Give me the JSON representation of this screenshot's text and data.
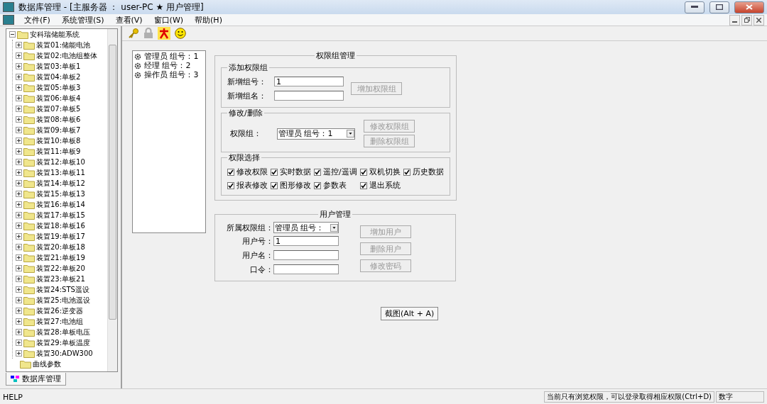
{
  "window": {
    "title": "数据库管理 - [主服务器 ： user-PC ★ 用户管理]"
  },
  "menu": [
    "文件(F)",
    "系统管理(S)",
    "查看(V)",
    "窗口(W)",
    "帮助(H)"
  ],
  "tree": {
    "label": "安科瑞储能系统",
    "expanded": true,
    "children": [
      {
        "label": "装置01:储能电池"
      },
      {
        "label": "装置02:电池组整体"
      },
      {
        "label": "装置03:单板1"
      },
      {
        "label": "装置04:单板2"
      },
      {
        "label": "装置05:单板3"
      },
      {
        "label": "装置06:单板4"
      },
      {
        "label": "装置07:单板5"
      },
      {
        "label": "装置08:单板6"
      },
      {
        "label": "装置09:单板7"
      },
      {
        "label": "装置10:单板8"
      },
      {
        "label": "装置11:单板9"
      },
      {
        "label": "装置12:单板10"
      },
      {
        "label": "装置13:单板11"
      },
      {
        "label": "装置14:单板12"
      },
      {
        "label": "装置15:单板13"
      },
      {
        "label": "装置16:单板14"
      },
      {
        "label": "装置17:单板15"
      },
      {
        "label": "装置18:单板16"
      },
      {
        "label": "装置19:单板17"
      },
      {
        "label": "装置20:单板18"
      },
      {
        "label": "装置21:单板19"
      },
      {
        "label": "装置22:单板20"
      },
      {
        "label": "装置23:单板21"
      },
      {
        "label": "装置24:STS遥设"
      },
      {
        "label": "装置25:电池遥设"
      },
      {
        "label": "装置26:逆变器"
      },
      {
        "label": "装置27:电池组"
      },
      {
        "label": "装置28:单板电压"
      },
      {
        "label": "装置29:单板温度"
      },
      {
        "label": "装置30:ADW300"
      }
    ]
  },
  "tree_extra": [
    "曲线参数"
  ],
  "left_tab": "数据库管理",
  "groups_list": [
    "管理员 组号：1",
    "经理 组号：2",
    "操作员 组号：3"
  ],
  "group_mgmt": {
    "title": "权限组管理",
    "add": {
      "title": "添加权限组",
      "fields": [
        {
          "label": "新增组号：",
          "value": "1"
        },
        {
          "label": "新增组名："
        }
      ],
      "button": {
        "label": "增加权限组",
        "disabled": true
      }
    },
    "edit": {
      "title": "修改/删除",
      "label": "权限组：",
      "value": "管理员 组号：1",
      "buttons": [
        {
          "label": "修改权限组",
          "disabled": true
        },
        {
          "label": "删除权限组",
          "disabled": true
        }
      ]
    },
    "perms": {
      "title": "权限选择",
      "items": [
        {
          "label": "修改权限",
          "checked": true
        },
        {
          "label": "实时数据",
          "checked": true
        },
        {
          "label": "遥控/遥调",
          "checked": true
        },
        {
          "label": "双机切换",
          "checked": true
        },
        {
          "label": "历史数据",
          "checked": true
        },
        {
          "label": "报表修改",
          "checked": true
        },
        {
          "label": "图形修改",
          "checked": true
        },
        {
          "label": "参数表",
          "checked": true
        },
        {
          "label": "退出系统",
          "checked": true
        }
      ]
    }
  },
  "user_mgmt": {
    "title": "用户管理",
    "group_label": "所属权限组：",
    "group_value": "管理员 组号：",
    "fields": [
      {
        "label": "用户号：",
        "value": "1"
      },
      {
        "label": "用户名："
      },
      {
        "label": "口令："
      }
    ],
    "buttons": [
      {
        "label": "增加用户",
        "disabled": true
      },
      {
        "label": "删除用户",
        "disabled": true
      },
      {
        "label": "修改密码",
        "disabled": true
      }
    ]
  },
  "screenshot_button": "截图(Alt + A)",
  "status_bar": {
    "left": "HELP",
    "message": "当前只有浏览权限，可以登录取得相应权限(Ctrl+D)",
    "mode": "数字"
  }
}
